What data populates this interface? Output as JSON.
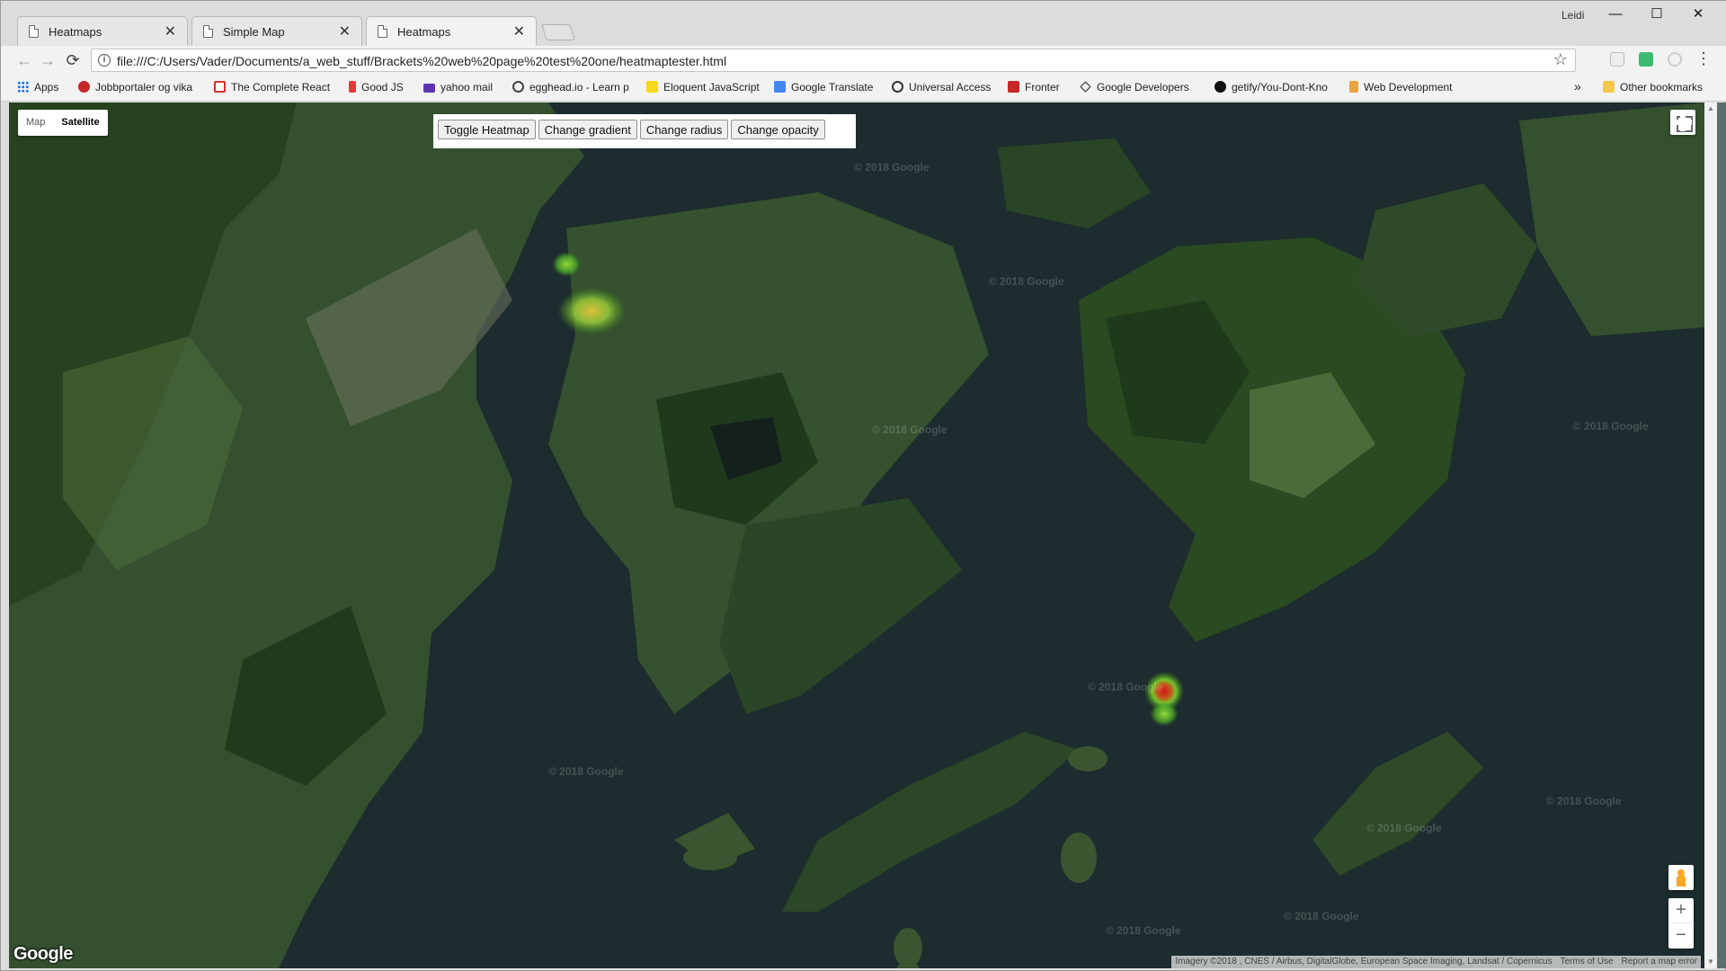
{
  "tabs": [
    {
      "title": "Heatmaps",
      "active": false
    },
    {
      "title": "Simple Map",
      "active": false
    },
    {
      "title": "Heatmaps",
      "active": true
    }
  ],
  "window": {
    "user": "Leidi",
    "minimize": "—",
    "maximize": "☐",
    "close": "✕"
  },
  "toolbar": {
    "back": "←",
    "forward": "→",
    "reload": "⟳",
    "url": "file:///C:/Users/Vader/Documents/a_web_stuff/Brackets%20web%20page%20test%20one/heatmaptester.html",
    "star": "☆"
  },
  "bookmarks": [
    {
      "label": "Apps",
      "icon": "apps-grid-icon",
      "color": "#1a73e8"
    },
    {
      "label": "Jobbportaler og vika",
      "icon": "red-circle-icon",
      "color": "#c62828"
    },
    {
      "label": "The Complete React",
      "icon": "udemy-icon",
      "color": "#d32f2f"
    },
    {
      "label": "Good JS",
      "icon": "figure-icon",
      "color": "#e53935"
    },
    {
      "label": "yahoo mail",
      "icon": "mail-icon",
      "color": "#5e35b1"
    },
    {
      "label": "egghead.io - Learn p",
      "icon": "egghead-icon",
      "color": "#444444"
    },
    {
      "label": "Eloquent JavaScript",
      "icon": "ejs-icon",
      "color": "#f9d71c"
    },
    {
      "label": "Google Translate",
      "icon": "translate-icon",
      "color": "#4285f4"
    },
    {
      "label": "Universal Access",
      "icon": "access-icon",
      "color": "#333333"
    },
    {
      "label": "Fronter",
      "icon": "fronter-icon",
      "color": "#c62828"
    },
    {
      "label": "Google Developers",
      "icon": "dev-icon",
      "color": "#555555"
    },
    {
      "label": "getify/You-Dont-Kno",
      "icon": "github-icon",
      "color": "#111111"
    },
    {
      "label": "Web Development",
      "icon": "webdev-icon",
      "color": "#e8a33a"
    }
  ],
  "bookmarks_more": "»",
  "other_bookmarks": "Other bookmarks",
  "map": {
    "maptype": {
      "map": "Map",
      "satellite": "Satellite",
      "selected": "Satellite"
    },
    "buttons": {
      "toggle": "Toggle Heatmap",
      "gradient": "Change gradient",
      "radius": "Change radius",
      "opacity": "Change opacity"
    },
    "zoom_in": "+",
    "zoom_out": "−",
    "logo": "Google",
    "watermark": "© 2018 Google",
    "attribution": {
      "imagery": "Imagery ©2018 , CNES / Airbus, DigitalGlobe, European Space Imaging, Landsat / Copernicus",
      "terms": "Terms of Use",
      "report": "Report a map error"
    }
  },
  "colors": {
    "water": "#1d2c2e",
    "land": "#2f4b2c",
    "heat_green": "#6fd32a",
    "heat_red": "#d11a1a"
  }
}
